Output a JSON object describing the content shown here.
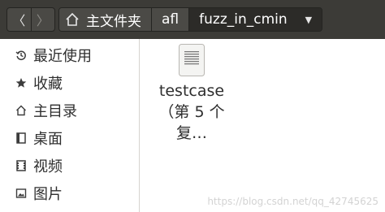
{
  "header": {
    "back_glyph": "〈",
    "forward_glyph": "〉",
    "breadcrumbs": [
      "主文件夹",
      "afl",
      "fuzz_in_cmin"
    ],
    "menu_glyph": "▼"
  },
  "sidebar": {
    "items": [
      {
        "label": "最近使用",
        "icon": "clock-icon"
      },
      {
        "label": "收藏",
        "icon": "star-icon"
      },
      {
        "label": "主目录",
        "icon": "home-icon"
      },
      {
        "label": "桌面",
        "icon": "desktop-icon"
      },
      {
        "label": "视频",
        "icon": "video-icon"
      },
      {
        "label": "图片",
        "icon": "picture-icon"
      }
    ]
  },
  "main": {
    "files": [
      {
        "name": "testcase（第 5 个复…",
        "icon": "text-document-icon"
      }
    ]
  },
  "watermark": "https://blog.csdn.net/qq_42745625",
  "colors": {
    "header_bg": "#3c3b37",
    "active_crumb_bg": "#2c2b28",
    "sidebar_bg": "#ffffff"
  }
}
